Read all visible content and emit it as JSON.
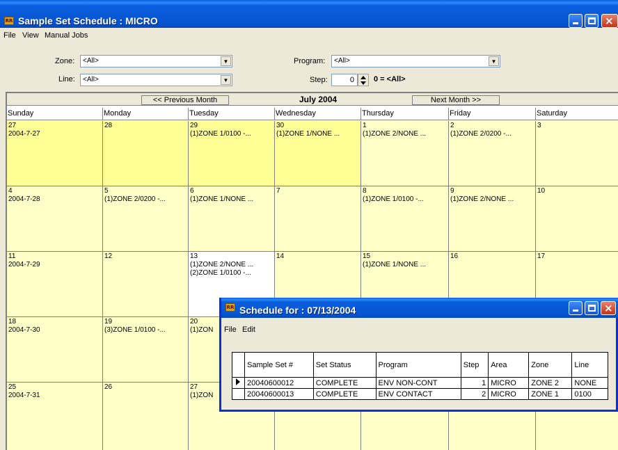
{
  "main_window": {
    "title": "Sample Set Schedule : MICRO",
    "menu": [
      "File",
      "View",
      "Manual Jobs"
    ],
    "filters": {
      "zone_label": "Zone:",
      "zone_value": "<All>",
      "line_label": "Line:",
      "line_value": "<All>",
      "program_label": "Program:",
      "program_value": "<All>",
      "step_label": "Step:",
      "step_value": "0",
      "step_note": "0 = <All>"
    }
  },
  "calendar": {
    "prev_label": "<< Previous Month",
    "next_label": "Next Month >>",
    "month_title": "July  2004",
    "day_headers": [
      "Sunday",
      "Monday",
      "Tuesday",
      "Wednesday",
      "Thursday",
      "Friday",
      "Saturday"
    ],
    "weeks": [
      [
        {
          "num": "27",
          "sub": "2004-7-27",
          "events": [],
          "style": "hl"
        },
        {
          "num": "28",
          "sub": "",
          "events": [],
          "style": "hl"
        },
        {
          "num": "29",
          "sub": "",
          "events": [
            "(1)ZONE 1/0100  -..."
          ],
          "style": "hl"
        },
        {
          "num": "30",
          "sub": "",
          "events": [
            "(1)ZONE 1/NONE  ..."
          ],
          "style": "hl"
        },
        {
          "num": "1",
          "sub": "",
          "events": [
            "(1)ZONE 2/NONE  ..."
          ],
          "style": ""
        },
        {
          "num": "2",
          "sub": "",
          "events": [
            "(1)ZONE 2/0200  -..."
          ],
          "style": ""
        },
        {
          "num": "3",
          "sub": "",
          "events": [],
          "style": ""
        }
      ],
      [
        {
          "num": "4",
          "sub": "2004-7-28",
          "events": [],
          "style": ""
        },
        {
          "num": "5",
          "sub": "",
          "events": [
            "(1)ZONE 2/0200  -..."
          ],
          "style": ""
        },
        {
          "num": "6",
          "sub": "",
          "events": [
            "(1)ZONE 1/NONE  ..."
          ],
          "style": ""
        },
        {
          "num": "7",
          "sub": "",
          "events": [],
          "style": ""
        },
        {
          "num": "8",
          "sub": "",
          "events": [
            "(1)ZONE 1/0100  -..."
          ],
          "style": ""
        },
        {
          "num": "9",
          "sub": "",
          "events": [
            "(1)ZONE 2/NONE  ..."
          ],
          "style": ""
        },
        {
          "num": "10",
          "sub": "",
          "events": [],
          "style": ""
        }
      ],
      [
        {
          "num": "11",
          "sub": "2004-7-29",
          "events": [],
          "style": ""
        },
        {
          "num": "12",
          "sub": "",
          "events": [],
          "style": ""
        },
        {
          "num": "13",
          "sub": "",
          "events": [
            "(1)ZONE 2/NONE  ...",
            "(2)ZONE 1/0100  -..."
          ],
          "style": "sel"
        },
        {
          "num": "14",
          "sub": "",
          "events": [],
          "style": ""
        },
        {
          "num": "15",
          "sub": "",
          "events": [
            "(1)ZONE 1/NONE  ..."
          ],
          "style": ""
        },
        {
          "num": "16",
          "sub": "",
          "events": [],
          "style": ""
        },
        {
          "num": "17",
          "sub": "",
          "events": [],
          "style": ""
        }
      ],
      [
        {
          "num": "18",
          "sub": "2004-7-30",
          "events": [],
          "style": ""
        },
        {
          "num": "19",
          "sub": "",
          "events": [
            "(3)ZONE 1/0100  -..."
          ],
          "style": ""
        },
        {
          "num": "20",
          "sub": "",
          "events": [
            "(1)ZON"
          ],
          "style": ""
        },
        {
          "num": "",
          "sub": "",
          "events": [],
          "style": ""
        },
        {
          "num": "",
          "sub": "",
          "events": [],
          "style": ""
        },
        {
          "num": "",
          "sub": "",
          "events": [],
          "style": ""
        },
        {
          "num": "",
          "sub": "",
          "events": [],
          "style": ""
        }
      ],
      [
        {
          "num": "25",
          "sub": "2004-7-31",
          "events": [],
          "style": ""
        },
        {
          "num": "26",
          "sub": "",
          "events": [],
          "style": ""
        },
        {
          "num": "27",
          "sub": "",
          "events": [
            "(1)ZON"
          ],
          "style": ""
        },
        {
          "num": "",
          "sub": "",
          "events": [],
          "style": ""
        },
        {
          "num": "",
          "sub": "",
          "events": [],
          "style": ""
        },
        {
          "num": "",
          "sub": "",
          "events": [],
          "style": ""
        },
        {
          "num": "",
          "sub": "",
          "events": [],
          "style": ""
        }
      ]
    ]
  },
  "dialog": {
    "title": "Schedule for : 07/13/2004",
    "menu": [
      "File",
      "Edit"
    ],
    "columns": [
      "Sample Set #",
      "Set Status",
      "Program",
      "Step",
      "Area",
      "Zone",
      "Line"
    ],
    "rows": [
      [
        "20040600012",
        "COMPLETE",
        "ENV NON-CONT",
        "1",
        "MICRO",
        "ZONE 2",
        "NONE"
      ],
      [
        "20040600013",
        "COMPLETE",
        "ENV CONTACT",
        "2",
        "MICRO",
        "ZONE 1",
        "0100"
      ]
    ]
  },
  "colors": {
    "titlebar": "#0a5fde",
    "cell_bg": "#ffffc8",
    "cell_highlight": "#ffff96",
    "window_face": "#ece9d8"
  }
}
